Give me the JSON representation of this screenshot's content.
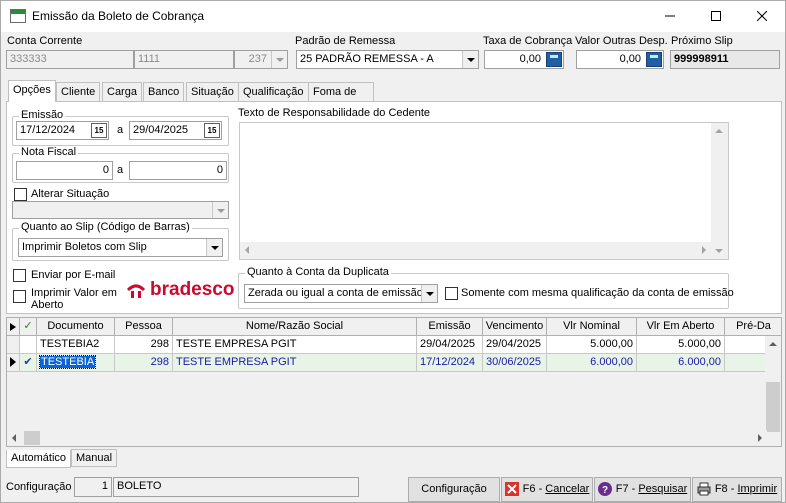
{
  "window": {
    "title": "Emissão da Boleto de Cobrança"
  },
  "header": {
    "conta_corrente_label": "Conta Corrente",
    "conta_corrente_code": "333333",
    "conta_corrente_agency": "1111",
    "conta_corrente_num": "237",
    "padrao_label": "Padrão de Remessa",
    "padrao_value": "25  PADRÃO REMESSA - A",
    "taxa_label": "Taxa de Cobrança",
    "taxa_value": "0,00",
    "valor_outras_label": "Valor Outras Desp.",
    "valor_outras_value": "0,00",
    "proximo_slip_label": "Próximo Slip",
    "proximo_slip_value": "999998911"
  },
  "tabs": [
    "Opções",
    "Cliente",
    "Carga",
    "Banco",
    "Situação",
    "Qualificação",
    "Foma de Pagamento"
  ],
  "options": {
    "emissao_label": "Emissão",
    "emissao_from": "17/12/2024",
    "emissao_to": "29/04/2025",
    "a_label": "a",
    "nota_fiscal_label": "Nota Fiscal",
    "nota_from": "0",
    "nota_to": "0",
    "alterar_situacao_label": "Alterar Situação",
    "quanto_slip_label": "Quanto ao Slip (Código de Barras)",
    "slip_value": "Imprimir Boletos com Slip",
    "enviar_email_label": "Enviar por E-mail",
    "imprimir_valor_label_1": "Imprimir Valor em",
    "imprimir_valor_label_2": "Aberto",
    "bank_logo_text": "bradesco",
    "texto_resp_label": "Texto de Responsabilidade do Cedente",
    "quanto_conta_label": "Quanto à Conta da Duplicata",
    "conta_value": "Zerada ou igual a conta de emissão",
    "somente_label": "Somente com mesma qualificação da conta de emissão"
  },
  "grid": {
    "check_header": "✓",
    "columns": [
      "Documento",
      "Pessoa",
      "Nome/Razão Social",
      "Emissão",
      "Vencimento",
      "Vlr Nominal",
      "Vlr Em Aberto",
      "Pré-Da"
    ],
    "rows": [
      {
        "documento": "TESTEBIA2",
        "pessoa": "298",
        "nome": "TESTE EMPRESA PGIT",
        "emissao": "29/04/2025",
        "vencimento": "29/04/2025",
        "nominal": "5.000,00",
        "aberto": "5.000,00",
        "checked": ""
      },
      {
        "documento": "TESTEBIA",
        "pessoa": "298",
        "nome": "TESTE EMPRESA PGIT",
        "emissao": "17/12/2024",
        "vencimento": "30/06/2025",
        "nominal": "6.000,00",
        "aberto": "6.000,00",
        "checked": "✔"
      }
    ]
  },
  "bottom_tabs": [
    "Automático",
    "Manual"
  ],
  "status": {
    "config_label": "Configuração",
    "config_num": "1",
    "config_value": "BOLETO"
  },
  "buttons": {
    "configuracao": "Configuração",
    "cancelar_key": "F6 - ",
    "cancelar_text": "Cancelar",
    "pesquisar_key": "F7 - ",
    "pesquisar_text": "Pesquisar",
    "imprimir_key": "F8 - ",
    "imprimir_text": "Imprimir"
  }
}
